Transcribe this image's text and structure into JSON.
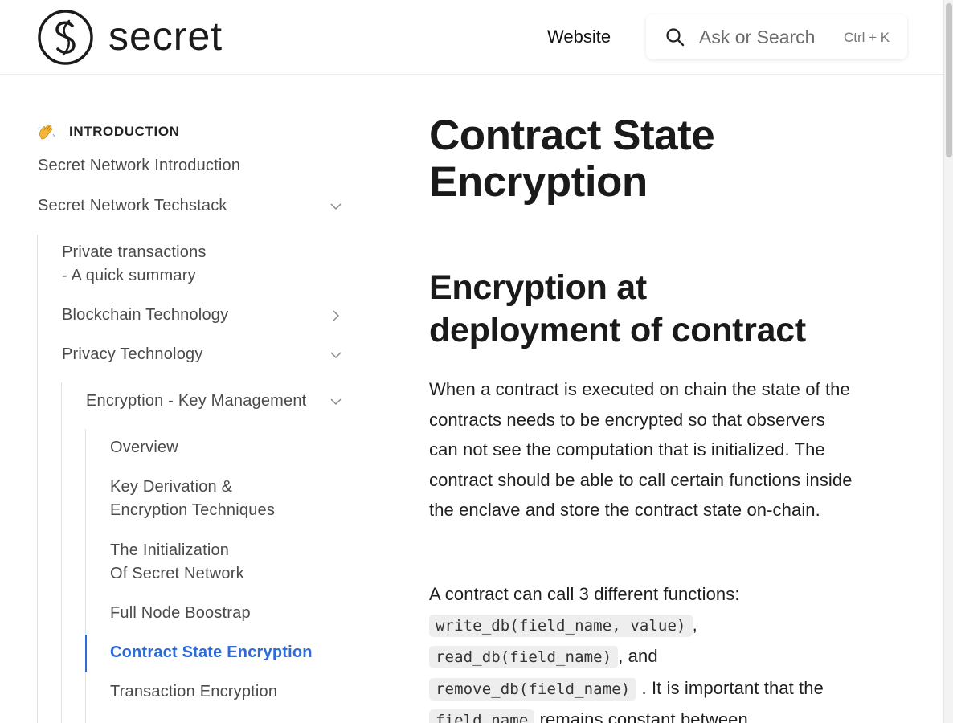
{
  "header": {
    "logo_text": "secret",
    "nav_website": "Website",
    "search_placeholder": "Ask or Search",
    "search_shortcut": "Ctrl + K"
  },
  "sidebar": {
    "section_title": "INTRODUCTION",
    "items": [
      {
        "label": "Secret Network Introduction"
      },
      {
        "label": "Secret Network Techstack"
      },
      {
        "label_line1": "Private transactions",
        "label_line2": "- A quick summary"
      },
      {
        "label": "Blockchain Technology"
      },
      {
        "label": "Privacy Technology"
      },
      {
        "label": "Encryption - Key Management"
      },
      {
        "label": "Overview"
      },
      {
        "label_line1": "Key Derivation &",
        "label_line2": "Encryption Techniques"
      },
      {
        "label_line1": "The Initialization",
        "label_line2": "Of Secret Network"
      },
      {
        "label": "Full Node Boostrap"
      },
      {
        "label": "Contract State Encryption"
      },
      {
        "label": "Transaction Encryption"
      }
    ]
  },
  "main": {
    "title_line1": "Contract State",
    "title_line2": "Encryption",
    "h2_line1": "Encryption at",
    "h2_line2": "deployment of contract",
    "paragraph1": "When a contract is executed on chain the state of the contracts needs to be encrypted so that observers can not see the computation that is initialized. The contract should be able to call certain functions inside the enclave and store the contract state on-chain.",
    "paragraph2": {
      "intro": "A contract can call 3 different functions:",
      "code1": "write_db(field_name, value)",
      "sep1": ",",
      "code2": "read_db(field_name)",
      "sep2": ", and",
      "code3": "remove_db(field_name)",
      "text_after": ". It is important that the",
      "code4": "field_name",
      "text_tail": "remains constant between"
    }
  },
  "colors": {
    "accent": "#2f6bd7",
    "text": "#1f1f1f",
    "sidebar_text": "#4a4a4a"
  }
}
